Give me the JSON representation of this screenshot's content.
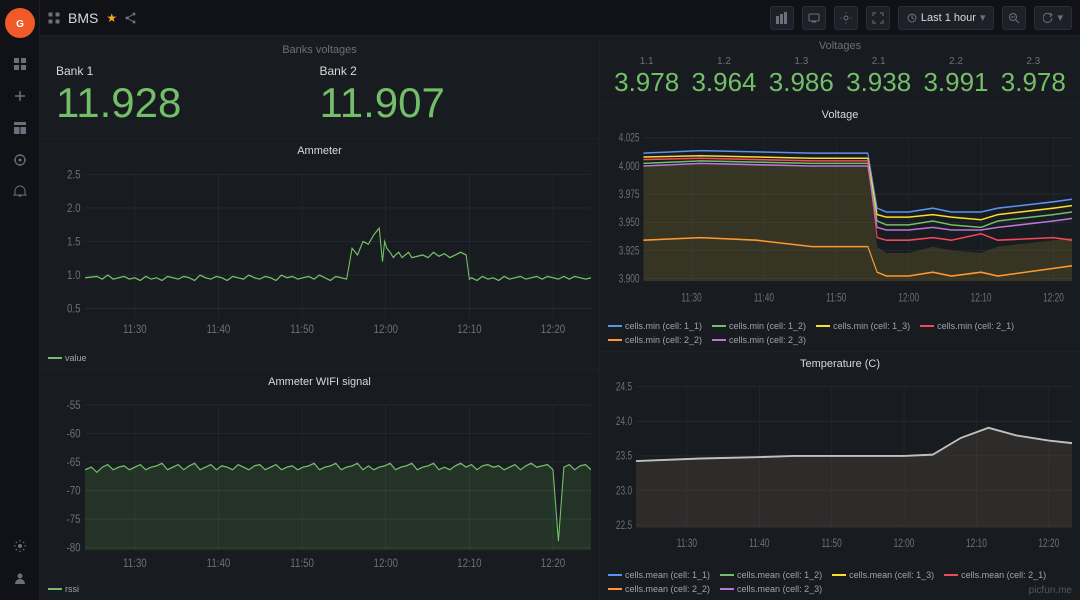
{
  "sidebar": {
    "logo": "G",
    "items": [
      {
        "name": "home",
        "icon": "⊞",
        "active": false
      },
      {
        "name": "plus",
        "icon": "+",
        "active": false
      },
      {
        "name": "grid",
        "icon": "⊟",
        "active": false
      },
      {
        "name": "compass",
        "icon": "◎",
        "active": false
      },
      {
        "name": "bell",
        "icon": "🔔",
        "active": false
      },
      {
        "name": "settings",
        "icon": "⚙",
        "active": false
      },
      {
        "name": "user",
        "icon": "👤",
        "active": false
      }
    ]
  },
  "topbar": {
    "app_name": "BMS",
    "buttons": {
      "chart": "📊",
      "tv": "🖥",
      "settings": "⚙",
      "screen": "⬜",
      "time_range": "Last 1 hour",
      "zoom_out": "🔍",
      "refresh": "↻",
      "dropdown": "▾"
    }
  },
  "banks": {
    "title": "Banks voltages",
    "bank1_label": "Bank 1",
    "bank1_value": "11.928",
    "bank2_label": "Bank 2",
    "bank2_value": "11.907"
  },
  "voltages": {
    "title": "Voltages",
    "cells": [
      {
        "id": "1.1",
        "value": "3.978"
      },
      {
        "id": "1.2",
        "value": "3.964"
      },
      {
        "id": "1.3",
        "value": "3.986"
      },
      {
        "id": "2.1",
        "value": "3.938"
      },
      {
        "id": "2.2",
        "value": "3.991"
      },
      {
        "id": "2.3",
        "value": "3.978"
      }
    ]
  },
  "ammeter_chart": {
    "title": "Ammeter",
    "y_labels": [
      "2.5",
      "2.0",
      "1.5",
      "1.0",
      "0.5"
    ],
    "x_labels": [
      "11:30",
      "11:40",
      "11:50",
      "12:00",
      "12:10",
      "12:20"
    ],
    "legend": [
      {
        "label": "value",
        "color": "#73bf69"
      }
    ]
  },
  "wifi_chart": {
    "title": "Ammeter WIFI signal",
    "y_labels": [
      "-55",
      "-60",
      "-65",
      "-70",
      "-75",
      "-80"
    ],
    "x_labels": [
      "11:30",
      "11:40",
      "11:50",
      "12:00",
      "12:10",
      "12:20"
    ],
    "legend": [
      {
        "label": "rssi",
        "color": "#73bf69"
      }
    ]
  },
  "voltage_chart": {
    "title": "Voltage",
    "y_labels": [
      "4.025",
      "4.000",
      "3.975",
      "3.950",
      "3.925",
      "3.900"
    ],
    "x_labels": [
      "11:30",
      "11:40",
      "11:50",
      "12:00",
      "12:10",
      "12:20"
    ],
    "legend": [
      {
        "label": "cells.min (cell: 1_1)",
        "color": "#5794f2"
      },
      {
        "label": "cells.min (cell: 1_2)",
        "color": "#73bf69"
      },
      {
        "label": "cells.min (cell: 1_3)",
        "color": "#fade2a"
      },
      {
        "label": "cells.min (cell: 2_1)",
        "color": "#f2495c"
      },
      {
        "label": "cells.min (cell: 2_2)",
        "color": "#ff9830"
      },
      {
        "label": "cells.min (cell: 2_3)",
        "color": "#b877d9"
      }
    ]
  },
  "temp_chart": {
    "title": "Temperature (C)",
    "y_labels": [
      "24.5",
      "24.0",
      "23.5",
      "23.0",
      "22.5"
    ],
    "x_labels": [
      "11:30",
      "11:40",
      "11:50",
      "12:00",
      "12:10",
      "12:20"
    ],
    "legend": [
      {
        "label": "cells.mean (cell: 1_1)",
        "color": "#5794f2"
      },
      {
        "label": "cells.mean (cell: 1_2)",
        "color": "#73bf69"
      },
      {
        "label": "cells.mean (cell: 1_3)",
        "color": "#fade2a"
      },
      {
        "label": "cells.mean (cell: 2_1)",
        "color": "#f2495c"
      },
      {
        "label": "cells.mean (cell: 2_2)",
        "color": "#ff9830"
      },
      {
        "label": "cells.mean (cell: 2_3)",
        "color": "#b877d9"
      }
    ]
  },
  "watermark": "picfun.me"
}
